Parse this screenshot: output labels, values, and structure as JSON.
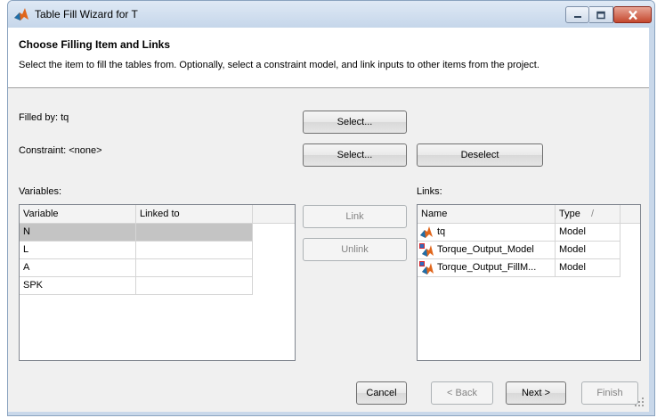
{
  "window": {
    "title": "Table Fill Wizard for T",
    "accent": "#c4482e"
  },
  "header": {
    "title": "Choose Filling Item and Links",
    "description": "Select the item to fill the tables from. Optionally, select a constraint model, and link inputs to other items from the project."
  },
  "filled_by": {
    "label": "Filled by: tq",
    "select_label": "Select..."
  },
  "constraint": {
    "label": "Constraint: <none>",
    "select_label": "Select...",
    "deselect_label": "Deselect"
  },
  "variables": {
    "label": "Variables:",
    "columns": [
      "Variable",
      "Linked to"
    ],
    "rows": [
      {
        "variable": "N",
        "linked_to": ""
      },
      {
        "variable": "L",
        "linked_to": ""
      },
      {
        "variable": "A",
        "linked_to": ""
      },
      {
        "variable": "SPK",
        "linked_to": ""
      }
    ]
  },
  "link_buttons": {
    "link": "Link",
    "unlink": "Unlink"
  },
  "links": {
    "label": "Links:",
    "columns": [
      "Name",
      "Type"
    ],
    "sort_indicator": "/",
    "rows": [
      {
        "name": "tq",
        "type": "Model",
        "icon": "model-icon"
      },
      {
        "name": "Torque_Output_Model",
        "type": "Model",
        "icon": "linked-model-icon"
      },
      {
        "name": "Torque_Output_FillM...",
        "type": "Model",
        "icon": "linked-model-icon"
      }
    ]
  },
  "footer": {
    "cancel": "Cancel",
    "back": "< Back",
    "next": "Next >",
    "finish": "Finish"
  }
}
